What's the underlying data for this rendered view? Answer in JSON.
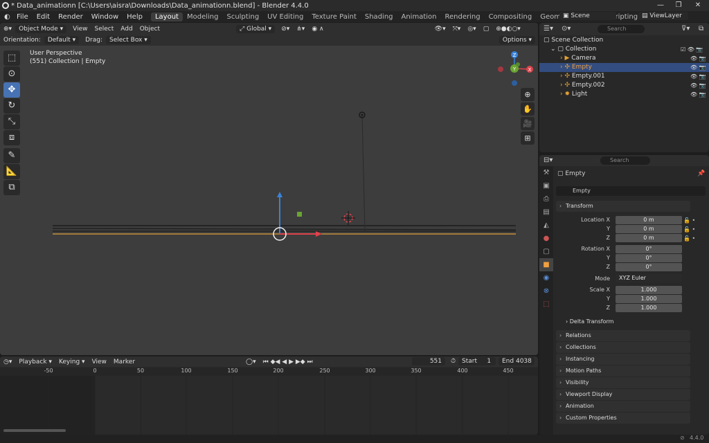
{
  "window": {
    "title": "* Data_animationn [C:\\Users\\aisra\\Downloads\\Data_animationn.blend] - Blender 4.4.0",
    "min_icon": "—",
    "max_icon": "❐",
    "close_icon": "✕"
  },
  "menu": [
    "File",
    "Edit",
    "Render",
    "Window",
    "Help"
  ],
  "workspaces": [
    "Layout",
    "Modeling",
    "Sculpting",
    "UV Editing",
    "Texture Paint",
    "Shading",
    "Animation",
    "Rendering",
    "Compositing",
    "Geometry Nodes",
    "Scripting"
  ],
  "workspace_add": "+",
  "scene": {
    "name": "Scene",
    "view_layer": "ViewLayer"
  },
  "viewport": {
    "mode": "Object Mode",
    "menus": [
      "View",
      "Select",
      "Add",
      "Object"
    ],
    "transform_orientation": "Global",
    "orientation_label": "Orientation:",
    "orientation_value": "Default",
    "drag_label": "Drag:",
    "drag_value": "Select Box",
    "options_label": "Options",
    "overlay_line1": "User Perspective",
    "overlay_line2": "(551) Collection | Empty",
    "gizmo": {
      "x": "X",
      "y": "Y",
      "z": "Z"
    }
  },
  "outliner": {
    "search_placeholder": "Search",
    "root": "Scene Collection",
    "collection": "Collection",
    "items": [
      {
        "label": "Camera",
        "selected": false
      },
      {
        "label": "Empty",
        "selected": true
      },
      {
        "label": "Empty.001",
        "selected": false
      },
      {
        "label": "Empty.002",
        "selected": false
      },
      {
        "label": "Light",
        "selected": false
      }
    ]
  },
  "properties": {
    "search_placeholder": "Search",
    "object_name": "Empty",
    "datablock_name": "Empty",
    "transform_label": "Transform",
    "location_label": "Location X",
    "location": [
      "0 m",
      "0 m",
      "0 m"
    ],
    "rotation_label": "Rotation X",
    "rotation": [
      "0°",
      "0°",
      "0°"
    ],
    "mode_label": "Mode",
    "mode_value": "XYZ Euler",
    "scale_label": "Scale X",
    "scale": [
      "1.000",
      "1.000",
      "1.000"
    ],
    "axis_y": "Y",
    "axis_z": "Z",
    "delta_transform": "Delta Transform",
    "sections": [
      "Relations",
      "Collections",
      "Instancing",
      "Motion Paths",
      "Visibility",
      "Viewport Display",
      "Animation",
      "Custom Properties"
    ]
  },
  "timeline": {
    "menus": [
      "Playback",
      "Keying",
      "View",
      "Marker"
    ],
    "current_frame": "551",
    "start_label": "Start",
    "start_value": "1",
    "end_label": "End",
    "end_value": "4038",
    "ticks": [
      "-50",
      "0",
      "50",
      "100",
      "150",
      "200",
      "250",
      "300",
      "350",
      "400",
      "450"
    ]
  },
  "status": {
    "version": "4.4.0"
  },
  "colors": {
    "accent": "#4772b3",
    "selected_row": "#334d80",
    "x_axis": "#e0424b",
    "y_axis": "#6aa532",
    "z_axis": "#3b82d6"
  }
}
